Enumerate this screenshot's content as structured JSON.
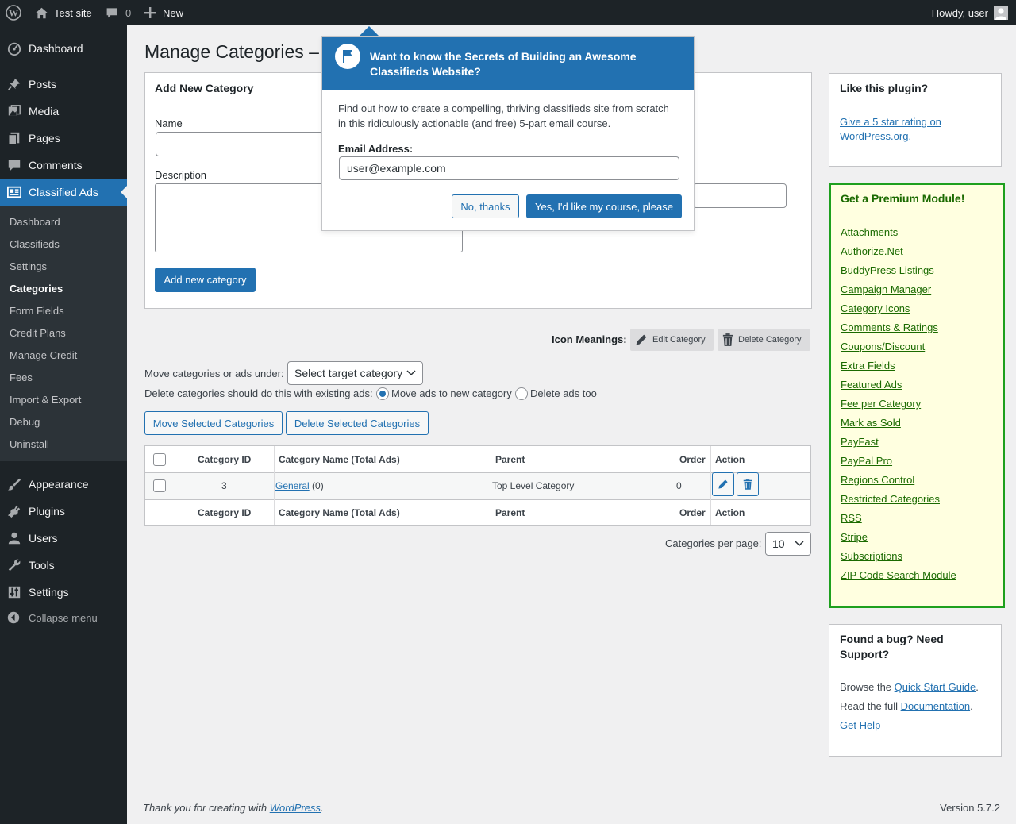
{
  "adminbar": {
    "site_name": "Test site",
    "comments_count": "0",
    "new_label": "New",
    "howdy": "Howdy, user"
  },
  "sidebar": {
    "top_items": [
      {
        "label": "Dashboard",
        "icon": "dashboard-icon"
      },
      {
        "label": "Posts",
        "icon": "pushpin-icon"
      },
      {
        "label": "Media",
        "icon": "media-icon"
      },
      {
        "label": "Pages",
        "icon": "pages-icon"
      },
      {
        "label": "Comments",
        "icon": "comment-icon"
      },
      {
        "label": "Classified Ads",
        "icon": "classified-ads-icon"
      }
    ],
    "submenu": [
      "Dashboard",
      "Classifieds",
      "Settings",
      "Categories",
      "Form Fields",
      "Credit Plans",
      "Manage Credit",
      "Fees",
      "Import & Export",
      "Debug",
      "Uninstall"
    ],
    "bottom_items": [
      {
        "label": "Appearance",
        "icon": "paintbrush-icon"
      },
      {
        "label": "Plugins",
        "icon": "plugin-icon"
      },
      {
        "label": "Users",
        "icon": "users-icon"
      },
      {
        "label": "Tools",
        "icon": "wrench-icon"
      },
      {
        "label": "Settings",
        "icon": "sliders-icon"
      }
    ],
    "collapse_label": "Collapse menu"
  },
  "page": {
    "title": "Manage Categories –"
  },
  "add_form": {
    "heading": "Add New Category",
    "name_label": "Name",
    "description_label": "Description",
    "submit_label": "Add new category"
  },
  "icon_meanings": {
    "label": "Icon Meanings:",
    "edit": "Edit Category",
    "delete": "Delete Category"
  },
  "bulk": {
    "move_label": "Move categories or ads under:",
    "select_value": "Select target category",
    "delete_label": "Delete categories should do this with existing ads:",
    "radio_move": "Move ads to new category",
    "radio_delete": "Delete ads too",
    "move_button": "Move Selected Categories",
    "delete_button": "Delete Selected Categories"
  },
  "table": {
    "headers": [
      "Category ID",
      "Category Name (Total Ads)",
      "Parent",
      "Order",
      "Action"
    ],
    "rows": [
      {
        "id": "3",
        "name": "General",
        "count": "(0)",
        "parent": "Top Level Category",
        "order": "0"
      }
    ]
  },
  "pagination": {
    "label": "Categories per page:",
    "value": "10"
  },
  "like_box": {
    "title": "Like this plugin?",
    "link": "Give a 5 star rating on WordPress.org."
  },
  "premium_box": {
    "title": "Get a Premium Module!",
    "links": [
      "Attachments",
      "Authorize.Net",
      "BuddyPress Listings",
      "Campaign Manager",
      "Category Icons",
      "Comments & Ratings",
      "Coupons/Discount",
      "Extra Fields",
      "Featured Ads",
      "Fee per Category",
      "Mark as Sold",
      "PayFast",
      "PayPal Pro",
      "Regions Control",
      "Restricted Categories",
      "RSS",
      "Stripe",
      "Subscriptions",
      "ZIP Code Search Module"
    ]
  },
  "support_box": {
    "title": "Found a bug? Need Support?",
    "browse_prefix": "Browse the",
    "quick_start": "Quick Start Guide",
    "read_prefix": "Read the full",
    "documentation": "Documentation",
    "period": ".",
    "get_help": "Get Help"
  },
  "popup": {
    "title": "Want to know the Secrets of Building an Awesome Classifieds Website?",
    "body": "Find out how to create a compelling, thriving classifieds site from scratch in this ridiculously actionable (and free) 5-part email course.",
    "email_label": "Email Address:",
    "email_value": "user@example.com",
    "no_button": "No, thanks",
    "yes_button": "Yes, I'd like my course, please"
  },
  "footer": {
    "thanks_prefix": "Thank you for creating with",
    "wordpress_link": "WordPress",
    "period": ".",
    "version": "Version 5.7.2"
  },
  "colors": {
    "admin_bar": "#1d2327",
    "accent": "#2271b1",
    "premium_border": "#1ea01e",
    "premium_bg": "#ffffe0"
  }
}
